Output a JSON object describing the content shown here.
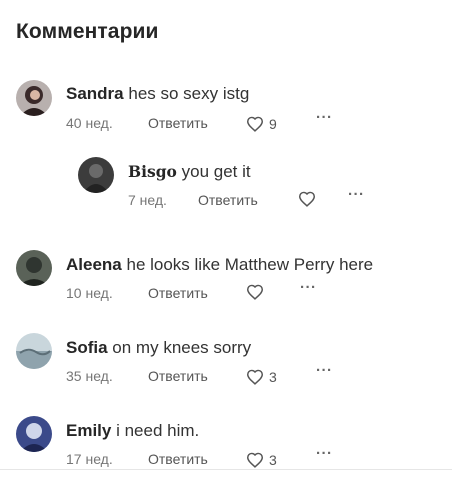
{
  "title": "Комментарии",
  "reply_label": "Ответить",
  "more_label": "···",
  "comments": [
    {
      "author": "Sandra",
      "text": "hes so sexy istg",
      "time": "40 нед.",
      "likes": "9"
    },
    {
      "author": "Bisgo",
      "text": "you get it",
      "time": "7 нед.",
      "likes": ""
    },
    {
      "author": "Aleena",
      "text": "he looks like Matthew Perry here",
      "time": "10 нед.",
      "likes": ""
    },
    {
      "author": "Sofia",
      "text": "on my knees sorry",
      "time": "35 нед.",
      "likes": "3"
    },
    {
      "author": "Emily",
      "text": "i need him.",
      "time": "17 нед.",
      "likes": "3"
    }
  ],
  "colors": {
    "text": "#262626",
    "meta": "#767676",
    "divider": "#e6e6e6"
  }
}
